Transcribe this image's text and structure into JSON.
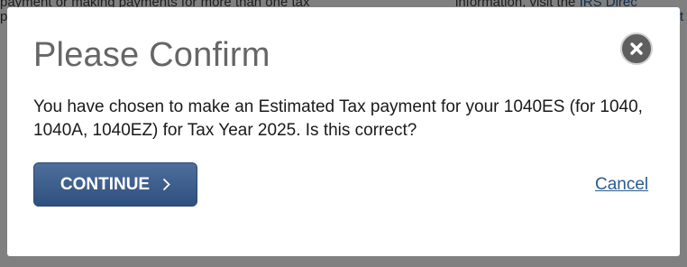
{
  "background": {
    "text_top_left": "payment or making payments for more than one tax",
    "text_top_left_2": "pe",
    "text_top_right": "information, visit the IRS Direc",
    "text_top_right_link": "IRS Direc",
    "text_right_2": "t"
  },
  "dialog": {
    "title": "Please Confirm",
    "message": "You have chosen to make an Estimated Tax payment for your 1040ES (for 1040, 1040A, 1040EZ) for Tax Year 2025. Is this correct?",
    "continue_label": "CONTINUE",
    "continue_icon": "chevron-right-icon",
    "cancel_label": "Cancel",
    "close_icon": "close-icon"
  },
  "colors": {
    "primary_button": "#2f507e",
    "link": "#2a5b8c",
    "title": "#666666"
  }
}
